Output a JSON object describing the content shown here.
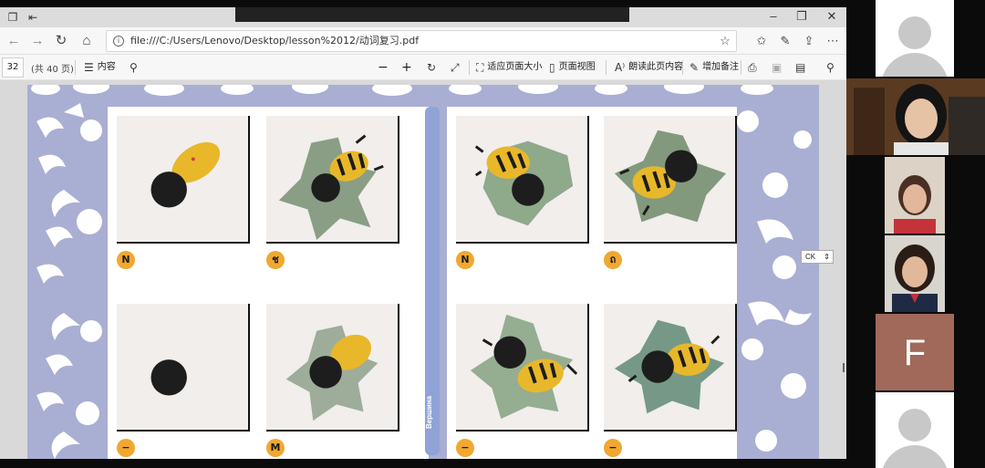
{
  "browser": {
    "url": "file:///C:/Users/Lenovo/Desktop/lesson%2012/动词复习.pdf",
    "back_icon": "back-arrow-icon",
    "forward_icon": "forward-arrow-icon",
    "refresh_icon": "refresh-icon",
    "home_icon": "home-icon"
  },
  "pdf_toolbar": {
    "page_number": "32",
    "page_count": "(共 40 页)",
    "contents_label": "内容",
    "zoom_out": "−",
    "zoom_in": "+",
    "fit_page_label": "适应页面大小",
    "page_view_label": "页面视图",
    "read_aloud_label": "朗读此页内容",
    "add_note_label": "增加备注"
  },
  "pdf_page": {
    "spine_label": "Вершина",
    "cards": [
      {
        "badge": "N"
      },
      {
        "badge": "ช"
      },
      {
        "badge": "N"
      },
      {
        "badge": "ถ"
      },
      {
        "badge": "−"
      },
      {
        "badge": "M"
      },
      {
        "badge": "−"
      },
      {
        "badge": "−"
      }
    ],
    "zoom_select": "CK"
  },
  "video_tiles": [
    {
      "type": "avatar"
    },
    {
      "type": "camera",
      "person": "woman-black-hair"
    },
    {
      "type": "camera",
      "person": "woman-red-top"
    },
    {
      "type": "camera",
      "person": "woman-dark-hair"
    },
    {
      "type": "initial",
      "letter": "F",
      "color": "#a0695a"
    },
    {
      "type": "avatar"
    }
  ],
  "colors": {
    "page_bg": "#a9aed3",
    "spine": "#8fa3d8",
    "badge": "#f0a830",
    "bee_yellow": "#e8b82a",
    "leaf_green": "#6f8a6a"
  }
}
